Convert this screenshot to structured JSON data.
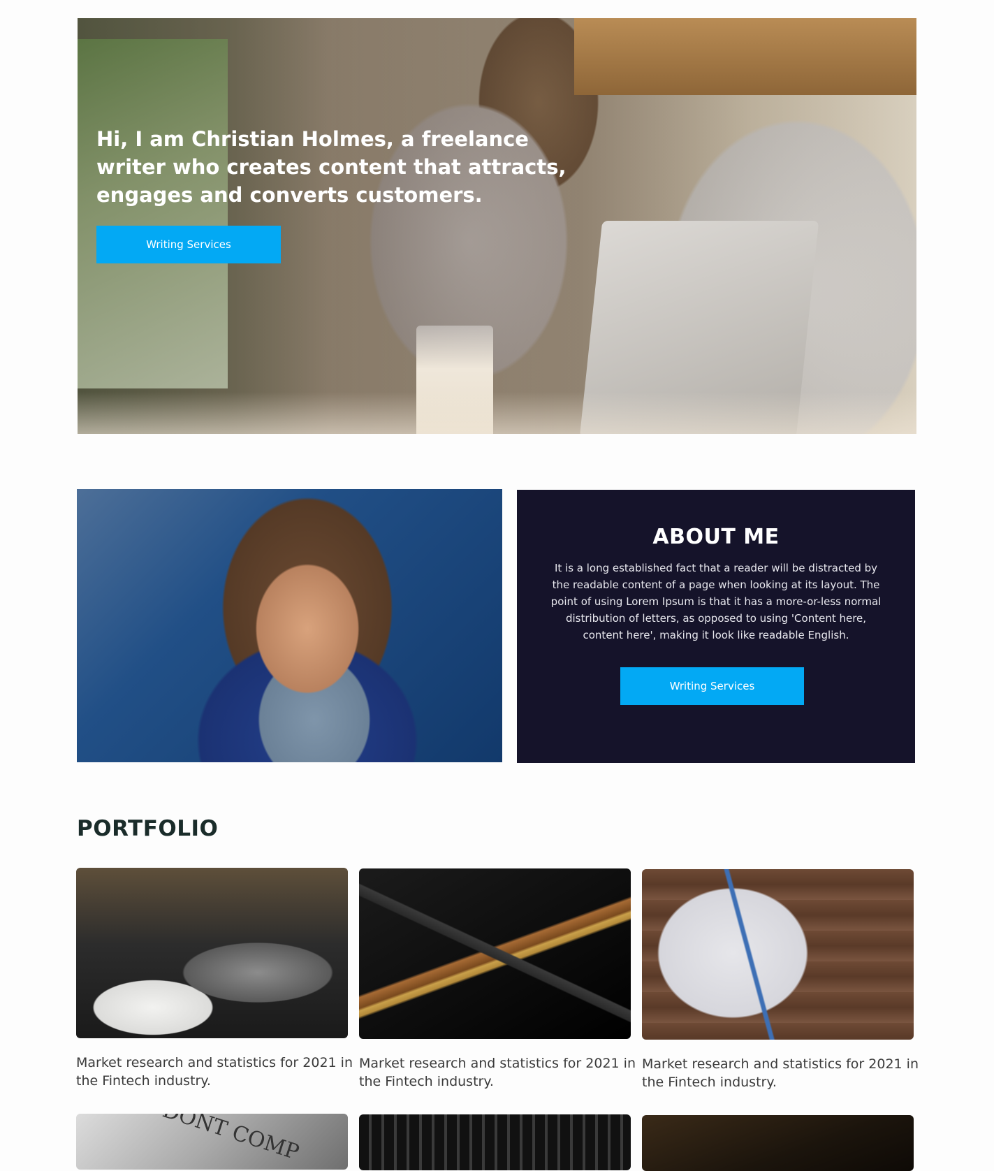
{
  "hero": {
    "title": "Hi, I am Christian Holmes, a freelance writer who creates content that attracts, engages and converts customers.",
    "button_label": "Writing Services"
  },
  "about": {
    "title": "ABOUT ME",
    "body": "It is a long established fact that a reader will be distracted by the readable content of a page when looking at its layout. The point of using Lorem Ipsum is that it has a more-or-less normal distribution of letters, as opposed to using 'Content here, content here', making it look like readable English.",
    "button_label": "Writing Services"
  },
  "portfolio": {
    "title": "PORTFOLIO",
    "items": [
      {
        "caption": "Market research and statistics for 2021 in the Fintech industry."
      },
      {
        "caption": "Market research and statistics for 2021 in the Fintech industry."
      },
      {
        "caption": "Market research and statistics for 2021 in the Fintech industry."
      }
    ],
    "partial_item_text": "DONT COMP"
  },
  "colors": {
    "accent": "#03a9f4",
    "about_panel": "#15132a",
    "heading": "#1a2c2a"
  }
}
